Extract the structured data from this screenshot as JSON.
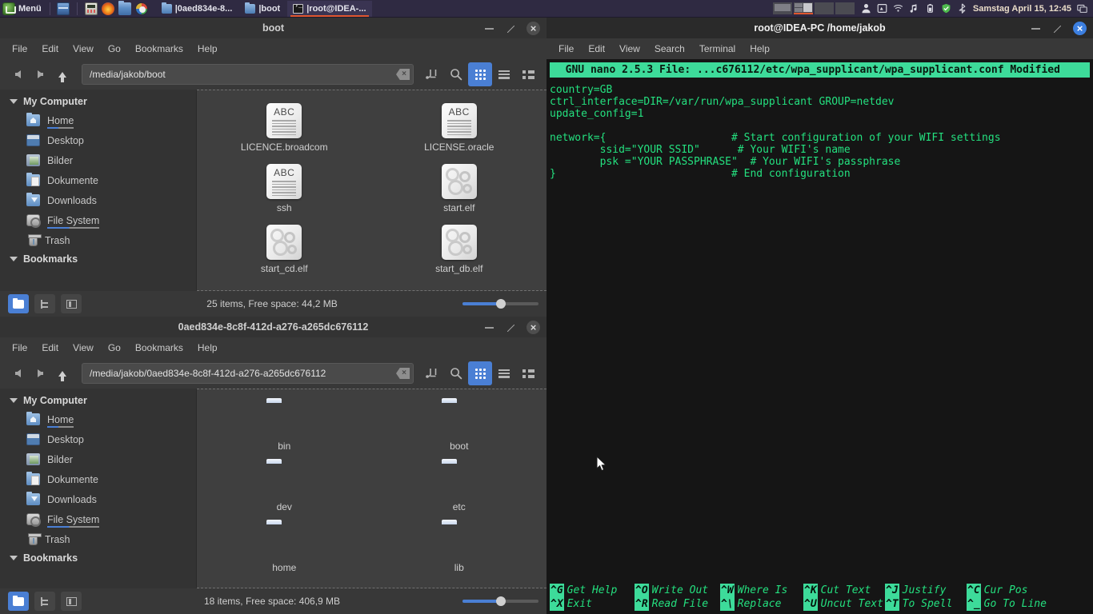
{
  "panel": {
    "menu_label": "Menü",
    "launchers": [
      {
        "name": "show-desktop",
        "icon": "desktop-icon"
      },
      {
        "name": "calculator",
        "icon": "calculator-icon"
      },
      {
        "name": "firefox",
        "icon": "firefox-icon"
      },
      {
        "name": "file-manager",
        "icon": "folder-icon"
      },
      {
        "name": "image-editor",
        "icon": "gimp-icon"
      }
    ],
    "tasks": [
      {
        "label": "|0aed834e-8...",
        "icon": "folder-icon",
        "active": false
      },
      {
        "label": "|boot",
        "icon": "folder-icon",
        "active": false
      },
      {
        "label": "|root@IDEA-...",
        "icon": "terminal-icon",
        "active": true
      }
    ],
    "workspaces": [
      {
        "label": "1",
        "active": false
      },
      {
        "label": "2",
        "active": true
      },
      {
        "label": "3",
        "active": false
      },
      {
        "label": "4",
        "active": false
      }
    ],
    "tray": [
      "user-icon",
      "display-settings-icon",
      "wifi-icon",
      "music-note-icon",
      "battery-icon",
      "shield-icon",
      "bluetooth-icon"
    ],
    "clock": "Samstag April 15, 12:45",
    "window_list_icon": "window-list-icon"
  },
  "window_boot": {
    "title": "boot",
    "menus": [
      "File",
      "Edit",
      "View",
      "Go",
      "Bookmarks",
      "Help"
    ],
    "path": "/media/jakob/boot",
    "toolbar": {
      "back": "back-arrow-icon",
      "forward": "forward-arrow-icon",
      "up": "up-arrow-icon",
      "clear": "clear-icon",
      "path_toggle": "path-entry-toggle-icon",
      "search": "search-icon",
      "icon_view": "icon-view-icon",
      "list_view": "list-view-icon",
      "compact_view": "compact-view-icon"
    },
    "sidebar": {
      "groups": [
        {
          "label": "My Computer",
          "items": [
            {
              "label": "Home",
              "icon": "home-folder-icon",
              "underlined": true
            },
            {
              "label": "Desktop",
              "icon": "desktop-folder-icon",
              "underlined": false
            },
            {
              "label": "Bilder",
              "icon": "pictures-folder-icon",
              "underlined": false
            },
            {
              "label": "Dokumente",
              "icon": "documents-folder-icon",
              "underlined": false
            },
            {
              "label": "Downloads",
              "icon": "downloads-folder-icon",
              "underlined": false
            },
            {
              "label": "File System",
              "icon": "harddisk-icon",
              "underlined": true
            },
            {
              "label": "Trash",
              "icon": "trash-icon",
              "underlined": false
            }
          ]
        },
        {
          "label": "Bookmarks",
          "items": []
        }
      ]
    },
    "files": [
      {
        "name": "LICENCE.broadcom",
        "type": "text"
      },
      {
        "name": "LICENSE.oracle",
        "type": "text"
      },
      {
        "name": "ssh",
        "type": "text"
      },
      {
        "name": "start.elf",
        "type": "executable"
      },
      {
        "name": "start_cd.elf",
        "type": "executable"
      },
      {
        "name": "start_db.elf",
        "type": "executable"
      }
    ],
    "status": "25 items, Free space: 44,2 MB",
    "statusbar_buttons": [
      "icon-view-toggle",
      "tree-view-toggle",
      "side-pane-toggle"
    ]
  },
  "window_uuid": {
    "title": "0aed834e-8c8f-412d-a276-a265dc676112",
    "menus": [
      "File",
      "Edit",
      "View",
      "Go",
      "Bookmarks",
      "Help"
    ],
    "path": "/media/jakob/0aed834e-8c8f-412d-a276-a265dc676112",
    "sidebar": {
      "groups": [
        {
          "label": "My Computer",
          "items": [
            {
              "label": "Home",
              "icon": "home-folder-icon",
              "underlined": true
            },
            {
              "label": "Desktop",
              "icon": "desktop-folder-icon",
              "underlined": false
            },
            {
              "label": "Bilder",
              "icon": "pictures-folder-icon",
              "underlined": false
            },
            {
              "label": "Dokumente",
              "icon": "documents-folder-icon",
              "underlined": false
            },
            {
              "label": "Downloads",
              "icon": "downloads-folder-icon",
              "underlined": false
            },
            {
              "label": "File System",
              "icon": "harddisk-icon",
              "underlined": true
            },
            {
              "label": "Trash",
              "icon": "trash-icon",
              "underlined": false
            }
          ]
        },
        {
          "label": "Bookmarks",
          "items": []
        }
      ]
    },
    "files": [
      {
        "name": "bin",
        "type": "folder"
      },
      {
        "name": "boot",
        "type": "folder"
      },
      {
        "name": "dev",
        "type": "folder"
      },
      {
        "name": "etc",
        "type": "folder"
      },
      {
        "name": "home",
        "type": "folder"
      },
      {
        "name": "lib",
        "type": "folder"
      }
    ],
    "status": "18 items, Free space: 406,9 MB"
  },
  "terminal": {
    "title": "root@IDEA-PC /home/jakob",
    "menus": [
      "File",
      "Edit",
      "View",
      "Search",
      "Terminal",
      "Help"
    ],
    "nano_header": "  GNU nano 2.5.3 File: ...c676112/etc/wpa_supplicant/wpa_supplicant.conf Modified",
    "nano_lines": [
      "country=GB",
      "ctrl_interface=DIR=/var/run/wpa_supplicant GROUP=netdev",
      "update_config=1",
      "",
      "network={                    # Start configuration of your WIFI settings",
      "        ssid=\"YOUR SSID\"      # Your WIFI's name",
      "        psk =\"YOUR PASSPHRASE\"  # Your WIFI's passphrase",
      "}                            # End configuration"
    ],
    "shortcuts_row1": [
      {
        "key": "^G",
        "label": "Get Help"
      },
      {
        "key": "^O",
        "label": "Write Out"
      },
      {
        "key": "^W",
        "label": "Where Is"
      },
      {
        "key": "^K",
        "label": "Cut Text"
      },
      {
        "key": "^J",
        "label": "Justify"
      },
      {
        "key": "^C",
        "label": "Cur Pos"
      }
    ],
    "shortcuts_row2": [
      {
        "key": "^X",
        "label": "Exit"
      },
      {
        "key": "^R",
        "label": "Read File"
      },
      {
        "key": "^\\",
        "label": "Replace"
      },
      {
        "key": "^U",
        "label": "Uncut Text"
      },
      {
        "key": "^T",
        "label": "To Spell"
      },
      {
        "key": "^_",
        "label": "Go To Line"
      }
    ]
  },
  "colors": {
    "panel_bg": "#2f2a42",
    "accent_blue": "#4a7fd4",
    "accent_orange": "#e0562f",
    "terminal_green": "#24e07f",
    "nano_bar": "#3ddb9a"
  }
}
